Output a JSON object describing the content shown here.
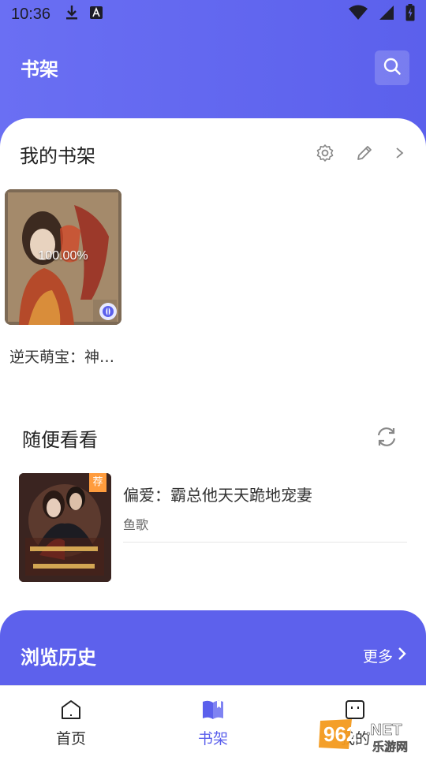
{
  "status_bar": {
    "time": "10:36"
  },
  "header": {
    "title": "书架"
  },
  "shelf": {
    "title": "我的书架",
    "books": [
      {
        "name": "逆天萌宝：神…",
        "progress": "100.00%"
      }
    ]
  },
  "random": {
    "title": "随便看看",
    "items": [
      {
        "name": "偏爱：霸总他天天跪地宠妻",
        "author": "鱼歌",
        "tag": "荐"
      }
    ]
  },
  "history": {
    "title": "浏览历史",
    "more": "更多"
  },
  "tabbar": {
    "tabs": [
      {
        "label": "首页"
      },
      {
        "label": "书架"
      },
      {
        "label": "我的"
      }
    ]
  },
  "watermark": {
    "text_a": "962",
    "text_b": ".NET",
    "text_c": "乐游网"
  },
  "colors": {
    "accent": "#5b60ec",
    "header_gradient_start": "#6a6ff3",
    "tag": "#ff9c3d"
  }
}
